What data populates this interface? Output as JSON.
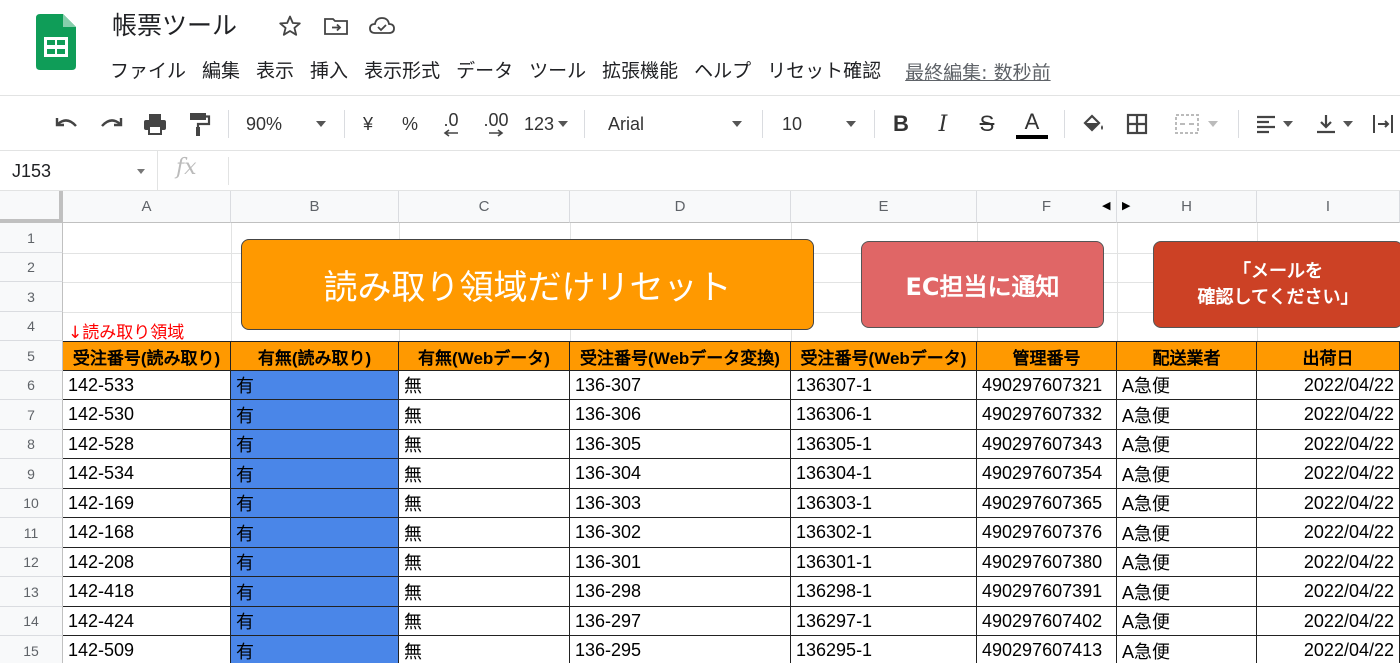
{
  "header": {
    "title": "帳票ツール",
    "menu": [
      "ファイル",
      "編集",
      "表示",
      "挿入",
      "表示形式",
      "データ",
      "ツール",
      "拡張機能",
      "ヘルプ",
      "リセット確認"
    ],
    "last_edit": "最終編集: 数秒前"
  },
  "toolbar": {
    "zoom": "90%",
    "currency": "¥",
    "percent": "%",
    "dec_decrease": ".0",
    "dec_increase": ".00",
    "more_formats": "123",
    "font": "Arial",
    "font_size": "10",
    "bold": "B",
    "italic": "I",
    "strike": "S",
    "text_color": "A"
  },
  "formula_bar": {
    "name_box": "J153",
    "fx": "fx",
    "value": ""
  },
  "grid": {
    "columns": [
      "A",
      "B",
      "C",
      "D",
      "E",
      "F",
      "H",
      "I"
    ],
    "row_numbers": [
      "1",
      "2",
      "3",
      "4",
      "5",
      "6",
      "7",
      "8",
      "9",
      "10",
      "11",
      "12",
      "13",
      "14",
      "15"
    ],
    "buttons": {
      "reset": "読み取り領域だけリセット",
      "ec_notify": "EC担当に通知",
      "mail_line1": "「メールを",
      "mail_line2": "確認してください」"
    },
    "read_area_label": "↓読み取り領域",
    "headers": [
      "受注番号(読み取り)",
      "有無(読み取り)",
      "有無(Webデータ)",
      "受注番号(Webデータ変換)",
      "受注番号(Webデータ)",
      "管理番号",
      "配送業者",
      "出荷日"
    ],
    "rows": [
      [
        "142-533",
        "有",
        "無",
        "136-307",
        "136307-1",
        "490297607321",
        "A急便",
        "2022/04/22"
      ],
      [
        "142-530",
        "有",
        "無",
        "136-306",
        "136306-1",
        "490297607332",
        "A急便",
        "2022/04/22"
      ],
      [
        "142-528",
        "有",
        "無",
        "136-305",
        "136305-1",
        "490297607343",
        "A急便",
        "2022/04/22"
      ],
      [
        "142-534",
        "有",
        "無",
        "136-304",
        "136304-1",
        "490297607354",
        "A急便",
        "2022/04/22"
      ],
      [
        "142-169",
        "有",
        "無",
        "136-303",
        "136303-1",
        "490297607365",
        "A急便",
        "2022/04/22"
      ],
      [
        "142-168",
        "有",
        "無",
        "136-302",
        "136302-1",
        "490297607376",
        "A急便",
        "2022/04/22"
      ],
      [
        "142-208",
        "有",
        "無",
        "136-301",
        "136301-1",
        "490297607380",
        "A急便",
        "2022/04/22"
      ],
      [
        "142-418",
        "有",
        "無",
        "136-298",
        "136298-1",
        "490297607391",
        "A急便",
        "2022/04/22"
      ],
      [
        "142-424",
        "有",
        "無",
        "136-297",
        "136297-1",
        "490297607402",
        "A急便",
        "2022/04/22"
      ],
      [
        "142-509",
        "有",
        "無",
        "136-295",
        "136295-1",
        "490297607413",
        "A急便",
        "2022/04/22"
      ]
    ]
  },
  "colors": {
    "header_orange": "#ff9900",
    "read_blue": "#4a86e8",
    "ec_button": "#e06666",
    "mail_button": "#cc4125",
    "read_label": "#ff0000",
    "sheets_green": "#0f9d58"
  },
  "icons": [
    "star-icon",
    "move-to-folder-icon",
    "cloud-status-icon",
    "undo-icon",
    "redo-icon",
    "print-icon",
    "paint-format-icon",
    "fill-color-icon",
    "borders-icon",
    "merge-cells-icon",
    "align-left-icon",
    "valign-bottom-icon",
    "text-wrap-icon"
  ]
}
